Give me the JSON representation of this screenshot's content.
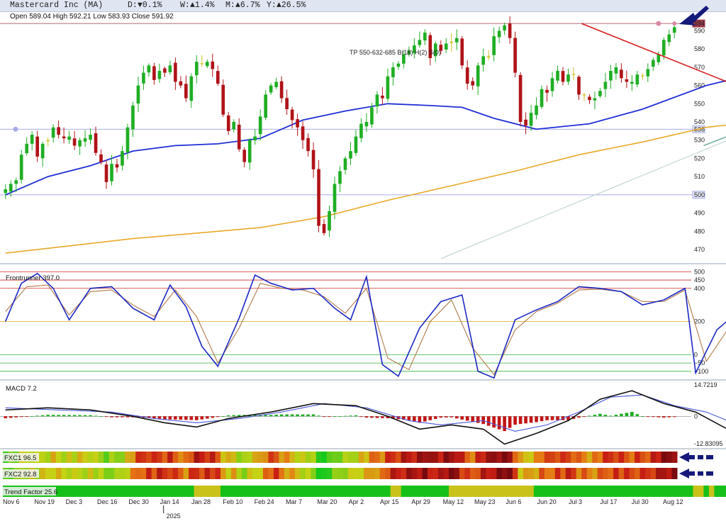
{
  "header": {
    "name": "Mastercard Inc (MA)",
    "d_label": "D:",
    "d_value": "▼0.1%",
    "w_label": "W:",
    "w_value": "▲1.4%",
    "m_label": "M:",
    "m_value": "▲6.7%",
    "y_label": "Y:",
    "y_value": "▲26.5%"
  },
  "ohlc": "Open 589.04  High 592.21  Low 583.93  Close 591.92",
  "chart_data": [
    {
      "panel": "price",
      "type": "candlestick",
      "x_labels": [
        "Nov 6",
        "Nov 19",
        "Dec 3",
        "Dec 16",
        "Dec 30",
        "Jan 14",
        "Jan 28",
        "Feb 10",
        "Feb 24",
        "Mar 7",
        "Mar 20",
        "Apr 2",
        "Apr 15",
        "Apr 29",
        "May 12",
        "May 23",
        "Jun 6",
        "Jun 20",
        "Jul 3",
        "Jul 17",
        "Jul 30",
        "Aug 12"
      ],
      "year_marker": "2025",
      "y_ticks": [
        470,
        480,
        490,
        500,
        510,
        520,
        530,
        540,
        550,
        560,
        570,
        580,
        590
      ],
      "ylim": [
        463,
        596
      ],
      "closes": [
        503,
        506,
        508,
        522,
        528,
        533,
        521,
        528,
        530,
        537,
        533,
        531,
        532,
        527,
        530,
        531,
        533,
        523,
        518,
        507,
        517,
        515,
        524,
        537,
        549,
        560,
        567,
        571,
        563,
        568,
        567,
        571,
        562,
        560,
        553,
        565,
        573,
        572,
        573,
        569,
        561,
        544,
        535,
        540,
        525,
        518,
        530,
        532,
        543,
        555,
        560,
        562,
        553,
        547,
        541,
        537,
        530,
        524,
        514,
        483,
        479,
        491,
        506,
        513,
        520,
        524,
        532,
        539,
        540,
        548,
        555,
        553,
        565,
        570,
        572,
        577,
        579,
        582,
        585,
        589,
        575,
        583,
        579,
        583,
        584,
        586,
        571,
        561,
        560,
        571,
        576,
        576,
        587,
        590,
        593,
        586,
        567,
        540,
        538,
        545,
        549,
        558,
        556,
        564,
        568,
        562,
        566,
        566,
        555,
        555,
        552,
        553,
        557,
        562,
        568,
        570,
        564,
        562,
        562,
        566,
        565,
        569,
        574,
        577,
        585,
        588,
        592
      ],
      "ma_blue_points": [
        [
          0,
          500
        ],
        [
          8,
          510
        ],
        [
          16,
          516
        ],
        [
          24,
          524
        ],
        [
          32,
          527
        ],
        [
          40,
          528
        ],
        [
          48,
          531
        ],
        [
          56,
          541
        ],
        [
          64,
          546
        ],
        [
          72,
          550
        ],
        [
          80,
          549
        ],
        [
          86,
          548
        ],
        [
          92,
          542
        ],
        [
          100,
          536
        ],
        [
          110,
          539
        ],
        [
          120,
          547
        ],
        [
          132,
          560
        ],
        [
          142,
          567
        ],
        [
          150,
          568
        ],
        [
          158,
          566
        ],
        [
          166,
          565
        ],
        [
          171,
          565
        ]
      ],
      "ma_orange_points": [
        [
          0,
          468
        ],
        [
          12,
          472
        ],
        [
          24,
          476
        ],
        [
          36,
          479
        ],
        [
          48,
          482
        ],
        [
          60,
          488
        ],
        [
          72,
          497
        ],
        [
          84,
          505
        ],
        [
          96,
          513
        ],
        [
          108,
          522
        ],
        [
          120,
          529
        ],
        [
          132,
          537
        ],
        [
          144,
          541
        ],
        [
          156,
          545
        ],
        [
          166,
          549
        ],
        [
          171,
          551
        ]
      ],
      "h_levels": [
        {
          "value": 594,
          "color": "#9c3a4a",
          "label": "594"
        },
        {
          "value": 536,
          "color": "#8f8fe8",
          "label": "536"
        },
        {
          "value": 500,
          "color": "#8f8fe8",
          "label": "500"
        }
      ],
      "annotation": "TP 550-632-685 B(18) H(2) S(0)"
    },
    {
      "panel": "Frontrunner",
      "type": "line",
      "label": "Frontrunner 397.0",
      "y_ticks": [
        500,
        450,
        400,
        200,
        0,
        -50,
        -100
      ],
      "blue_points": [
        [
          0,
          200
        ],
        [
          3,
          430
        ],
        [
          6,
          490
        ],
        [
          9,
          400
        ],
        [
          12,
          210
        ],
        [
          16,
          400
        ],
        [
          20,
          410
        ],
        [
          24,
          280
        ],
        [
          28,
          210
        ],
        [
          31,
          420
        ],
        [
          34,
          290
        ],
        [
          37,
          50
        ],
        [
          40,
          -70
        ],
        [
          44,
          220
        ],
        [
          47,
          480
        ],
        [
          50,
          430
        ],
        [
          54,
          390
        ],
        [
          58,
          400
        ],
        [
          62,
          280
        ],
        [
          65,
          210
        ],
        [
          68,
          470
        ],
        [
          71,
          -60
        ],
        [
          74,
          -130
        ],
        [
          78,
          160
        ],
        [
          82,
          320
        ],
        [
          86,
          360
        ],
        [
          89,
          -100
        ],
        [
          92,
          -140
        ],
        [
          96,
          210
        ],
        [
          100,
          270
        ],
        [
          104,
          320
        ],
        [
          108,
          410
        ],
        [
          112,
          400
        ],
        [
          116,
          380
        ],
        [
          120,
          300
        ],
        [
          124,
          330
        ],
        [
          128,
          400
        ],
        [
          130,
          -110
        ],
        [
          134,
          150
        ],
        [
          138,
          260
        ],
        [
          142,
          250
        ],
        [
          146,
          210
        ],
        [
          150,
          300
        ],
        [
          154,
          390
        ],
        [
          157,
          270
        ],
        [
          160,
          240
        ],
        [
          163,
          380
        ],
        [
          166,
          420
        ],
        [
          170,
          410
        ],
        [
          171,
          397
        ]
      ],
      "brown_points": [
        [
          0,
          260
        ],
        [
          4,
          410
        ],
        [
          8,
          420
        ],
        [
          12,
          240
        ],
        [
          16,
          380
        ],
        [
          20,
          390
        ],
        [
          24,
          300
        ],
        [
          28,
          230
        ],
        [
          32,
          390
        ],
        [
          36,
          230
        ],
        [
          40,
          -50
        ],
        [
          44,
          160
        ],
        [
          48,
          430
        ],
        [
          52,
          400
        ],
        [
          56,
          390
        ],
        [
          60,
          350
        ],
        [
          64,
          250
        ],
        [
          68,
          400
        ],
        [
          72,
          -20
        ],
        [
          76,
          -90
        ],
        [
          80,
          200
        ],
        [
          84,
          330
        ],
        [
          88,
          40
        ],
        [
          92,
          -120
        ],
        [
          96,
          150
        ],
        [
          100,
          260
        ],
        [
          104,
          310
        ],
        [
          108,
          390
        ],
        [
          112,
          395
        ],
        [
          116,
          380
        ],
        [
          120,
          320
        ],
        [
          124,
          320
        ],
        [
          128,
          390
        ],
        [
          132,
          -40
        ],
        [
          136,
          150
        ],
        [
          140,
          230
        ],
        [
          144,
          220
        ],
        [
          148,
          260
        ],
        [
          152,
          330
        ],
        [
          156,
          300
        ],
        [
          160,
          280
        ],
        [
          164,
          360
        ],
        [
          168,
          410
        ],
        [
          171,
          400
        ]
      ]
    },
    {
      "panel": "MACD",
      "type": "line+histogram",
      "label": "MACD 7.2",
      "y_ticks": [
        14.7219,
        0,
        -12.83095
      ],
      "ylim": [
        -12.83095,
        14.7219
      ],
      "black_points": [
        [
          0,
          3
        ],
        [
          8,
          4
        ],
        [
          16,
          3
        ],
        [
          24,
          0
        ],
        [
          30,
          -3
        ],
        [
          36,
          -5
        ],
        [
          42,
          -1
        ],
        [
          50,
          2
        ],
        [
          58,
          6
        ],
        [
          66,
          5
        ],
        [
          72,
          0
        ],
        [
          78,
          -6
        ],
        [
          84,
          -4
        ],
        [
          90,
          -6
        ],
        [
          94,
          -13
        ],
        [
          100,
          -8
        ],
        [
          106,
          -2
        ],
        [
          112,
          8
        ],
        [
          118,
          12
        ],
        [
          124,
          6
        ],
        [
          130,
          2
        ],
        [
          136,
          -6
        ],
        [
          140,
          -5
        ],
        [
          146,
          -2
        ],
        [
          152,
          0
        ],
        [
          160,
          1
        ],
        [
          166,
          4
        ],
        [
          171,
          7
        ]
      ],
      "blue_points": [
        [
          0,
          4
        ],
        [
          10,
          3
        ],
        [
          20,
          2
        ],
        [
          28,
          -1
        ],
        [
          36,
          -3
        ],
        [
          44,
          -1
        ],
        [
          52,
          2
        ],
        [
          60,
          6
        ],
        [
          68,
          4
        ],
        [
          76,
          -2
        ],
        [
          82,
          -4
        ],
        [
          90,
          -2
        ],
        [
          96,
          -7
        ],
        [
          102,
          -4
        ],
        [
          108,
          2
        ],
        [
          114,
          9
        ],
        [
          120,
          10
        ],
        [
          126,
          5
        ],
        [
          132,
          2
        ],
        [
          138,
          -4
        ],
        [
          144,
          -3
        ],
        [
          150,
          -1
        ],
        [
          158,
          0
        ],
        [
          164,
          2
        ],
        [
          171,
          5
        ]
      ]
    },
    {
      "panel": "FXC1",
      "type": "heatmap",
      "label": "FXC1 96.5"
    },
    {
      "panel": "FXC2",
      "type": "heatmap",
      "label": "FXC2 92.8"
    },
    {
      "panel": "Trend Factor",
      "type": "state-bar",
      "label": "Trend Factor 25.6",
      "segments": [
        [
          "g",
          0,
          36
        ],
        [
          "y",
          36,
          41
        ],
        [
          "g",
          41,
          73
        ],
        [
          "y",
          73,
          75
        ],
        [
          "g",
          75,
          84
        ],
        [
          "y",
          84,
          100
        ],
        [
          "g",
          100,
          130
        ],
        [
          "y",
          130,
          132
        ],
        [
          "g",
          132,
          133
        ],
        [
          "y",
          133,
          134
        ],
        [
          "g",
          134,
          141
        ],
        [
          "y",
          141,
          148
        ],
        [
          "g",
          148,
          155
        ],
        [
          "y",
          155,
          159
        ],
        [
          "g",
          159,
          171
        ]
      ]
    }
  ],
  "colors": {
    "up": "#1fae24",
    "down": "#b01318",
    "neutral": "#c9c21a",
    "ma_blue": "#1f2fd6",
    "ma_orange": "#e8a92a",
    "red_trend": "#d51c1c",
    "teal_trend": "#6aa79a"
  }
}
